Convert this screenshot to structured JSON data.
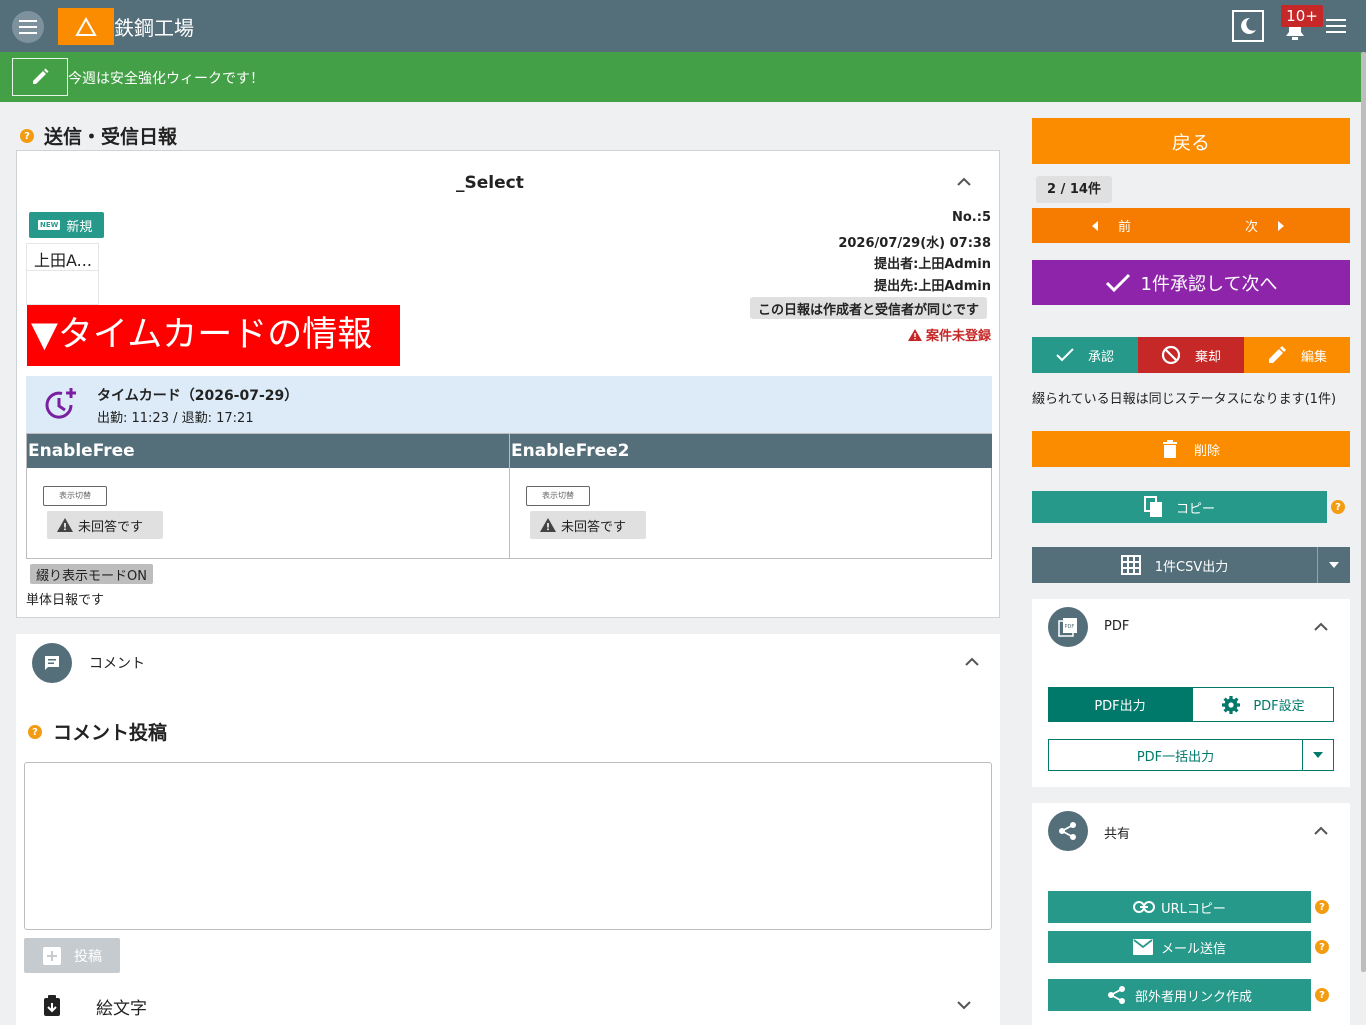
{
  "header": {
    "app_title": "鉄鋼工場",
    "notifications_badge": "10+",
    "icons": [
      "menu-icon",
      "warning-triangle-icon",
      "moon-icon",
      "bell-icon",
      "hamburger-icon"
    ]
  },
  "announcement": {
    "text": "今週は安全強化ウィークです！"
  },
  "page": {
    "title": "送信・受信日報"
  },
  "report": {
    "select_title": "_Select",
    "new_badge": "新規",
    "new_badge_icon": "NEW",
    "author_chip": "上田A...",
    "number": "No.:5",
    "datetime": "2026/07/29(水) 07:38",
    "submitter": "提出者:上田Admin",
    "recipient": "提出先:上田Admin",
    "same_notice": "この日報は作成者と受信者が同じです",
    "unregistered": "案件未登録",
    "timecard_banner": "▼タイムカードの情報",
    "timecard_title": "タイムカード（2026-07-29）",
    "timecard_detail": "出勤: 11:23 / 退勤: 17:21",
    "columns": [
      {
        "header": "EnableFree",
        "toggle_label": "表示切替",
        "status": "未回答です"
      },
      {
        "header": "EnableFree2",
        "toggle_label": "表示切替",
        "status": "未回答です"
      }
    ],
    "bind_mode": "綴り表示モードON",
    "single_report": "単体日報です"
  },
  "comment": {
    "section_label": "コメント",
    "post_title": "コメント投稿",
    "textarea_value": "",
    "post_button": "投稿",
    "emoji_label": "絵文字"
  },
  "side": {
    "back": "戻る",
    "pagination": "2 / 14件",
    "prev": "前",
    "next": "次",
    "approve_next": "1件承認して次へ",
    "approve": "承認",
    "reject": "棄却",
    "edit": "編集",
    "status_note": "綴られている日報は同じステータスになります(1件)",
    "delete": "削除",
    "copy": "コピー",
    "csv": "1件CSV出力",
    "pdf": {
      "label": "PDF",
      "export": "PDF出力",
      "settings": "PDF設定",
      "bulk": "PDF一括出力"
    },
    "share": {
      "label": "共有",
      "url_copy": "URLコピー",
      "mail": "メール送信",
      "external_link": "部外者用リンク作成"
    }
  },
  "colors": {
    "topbar": "#546e7a",
    "announce": "#43a047",
    "orange": "#fb8c00",
    "deep_orange": "#f57c00",
    "purple": "#8e24aa",
    "teal": "#26998a",
    "dark_teal": "#00796b",
    "red": "#c62828",
    "grey_blue": "#546e7a"
  }
}
